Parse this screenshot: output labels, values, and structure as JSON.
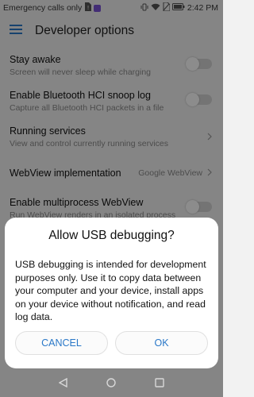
{
  "status_bar": {
    "carrier_text": "Emergency calls only",
    "time": "2:42 PM",
    "icons": [
      "sim-warning-icon",
      "notification-badge-icon",
      "vibrate-icon",
      "wifi-icon",
      "no-sim-icon",
      "battery-icon"
    ],
    "badge_color": "#7b52d6"
  },
  "app_bar": {
    "title": "Developer options",
    "menu_icon": "hamburger-menu-icon",
    "accent": "#2a78c8"
  },
  "settings": [
    {
      "title": "Stay awake",
      "subtitle": "Screen will never sleep while charging",
      "control": "switch",
      "enabled": false
    },
    {
      "title": "Enable Bluetooth HCI snoop log",
      "subtitle": "Capture all Bluetooth HCI packets in a file",
      "control": "switch",
      "enabled": false
    },
    {
      "title": "Running services",
      "subtitle": "View and control currently running services",
      "control": "chevron"
    },
    {
      "title": "WebView implementation",
      "value": "Google WebView",
      "control": "chevron"
    },
    {
      "title": "Enable multiprocess WebView",
      "subtitle": "Run WebView renders in an isolated process",
      "control": "switch",
      "enabled": false
    }
  ],
  "dialog": {
    "title": "Allow USB debugging?",
    "message": "USB debugging is intended for development purposes only. Use it to copy data between your computer and your device, install apps on your device without notification, and read log data.",
    "cancel_label": "CANCEL",
    "ok_label": "OK",
    "button_color": "#2a78c8"
  },
  "nav_bar": {
    "icons": [
      "back-icon",
      "home-icon",
      "recents-icon"
    ]
  }
}
